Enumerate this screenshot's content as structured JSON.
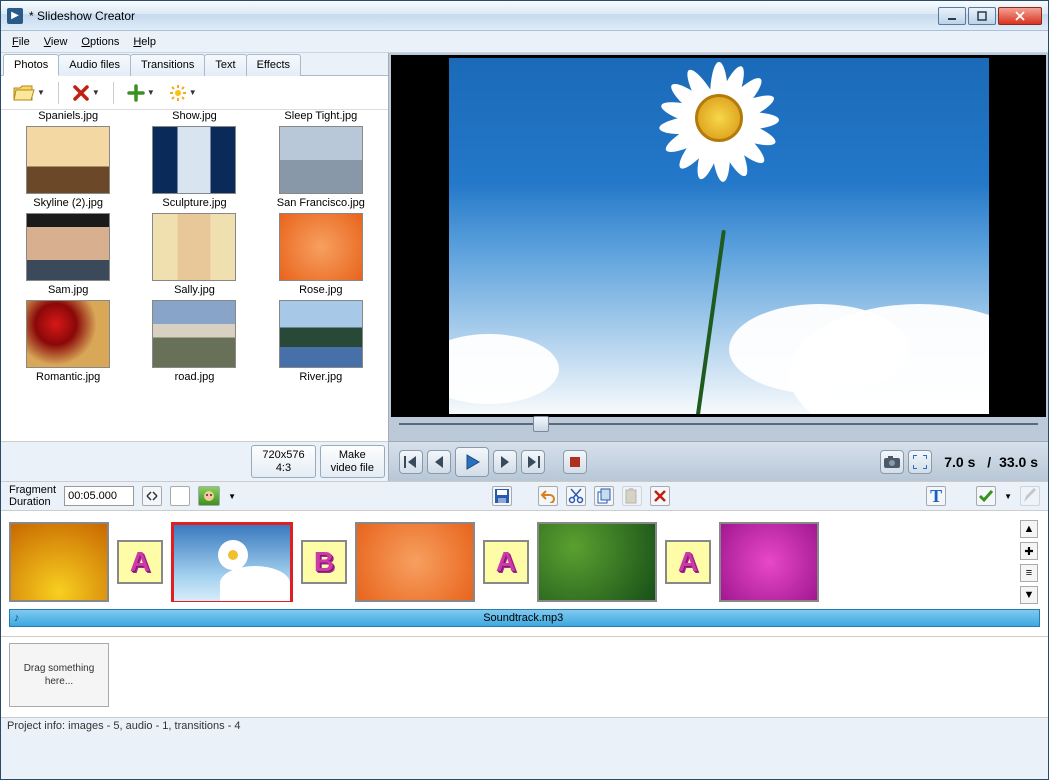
{
  "window": {
    "title": "*  Slideshow Creator"
  },
  "menu": {
    "file": "File",
    "view": "View",
    "options": "Options",
    "help": "Help"
  },
  "tabs": {
    "photos": "Photos",
    "audio": "Audio files",
    "transitions": "Transitions",
    "text": "Text",
    "effects": "Effects"
  },
  "gallery": {
    "row0": [
      "Spaniels.jpg",
      "Show.jpg",
      "Sleep Tight.jpg"
    ],
    "row1": [
      "Skyline (2).jpg",
      "Sculpture.jpg",
      "San Francisco.jpg"
    ],
    "row2": [
      "Sam.jpg",
      "Sally.jpg",
      "Rose.jpg"
    ],
    "row3": [
      "Romantic.jpg",
      "road.jpg",
      "River.jpg"
    ]
  },
  "resolution": {
    "line1": "720x576",
    "line2": "4:3"
  },
  "makevideo": {
    "line1": "Make",
    "line2": "video file"
  },
  "time": {
    "current": "7.0 s",
    "sep": "/",
    "total": "33.0 s"
  },
  "fragment": {
    "label1": "Fragment",
    "label2": "Duration",
    "value": "00:05.000"
  },
  "audio": {
    "track": "Soundtrack.mp3"
  },
  "drop": {
    "text": "Drag something here..."
  },
  "status": "Project info: images - 5, audio - 1, transitions - 4"
}
